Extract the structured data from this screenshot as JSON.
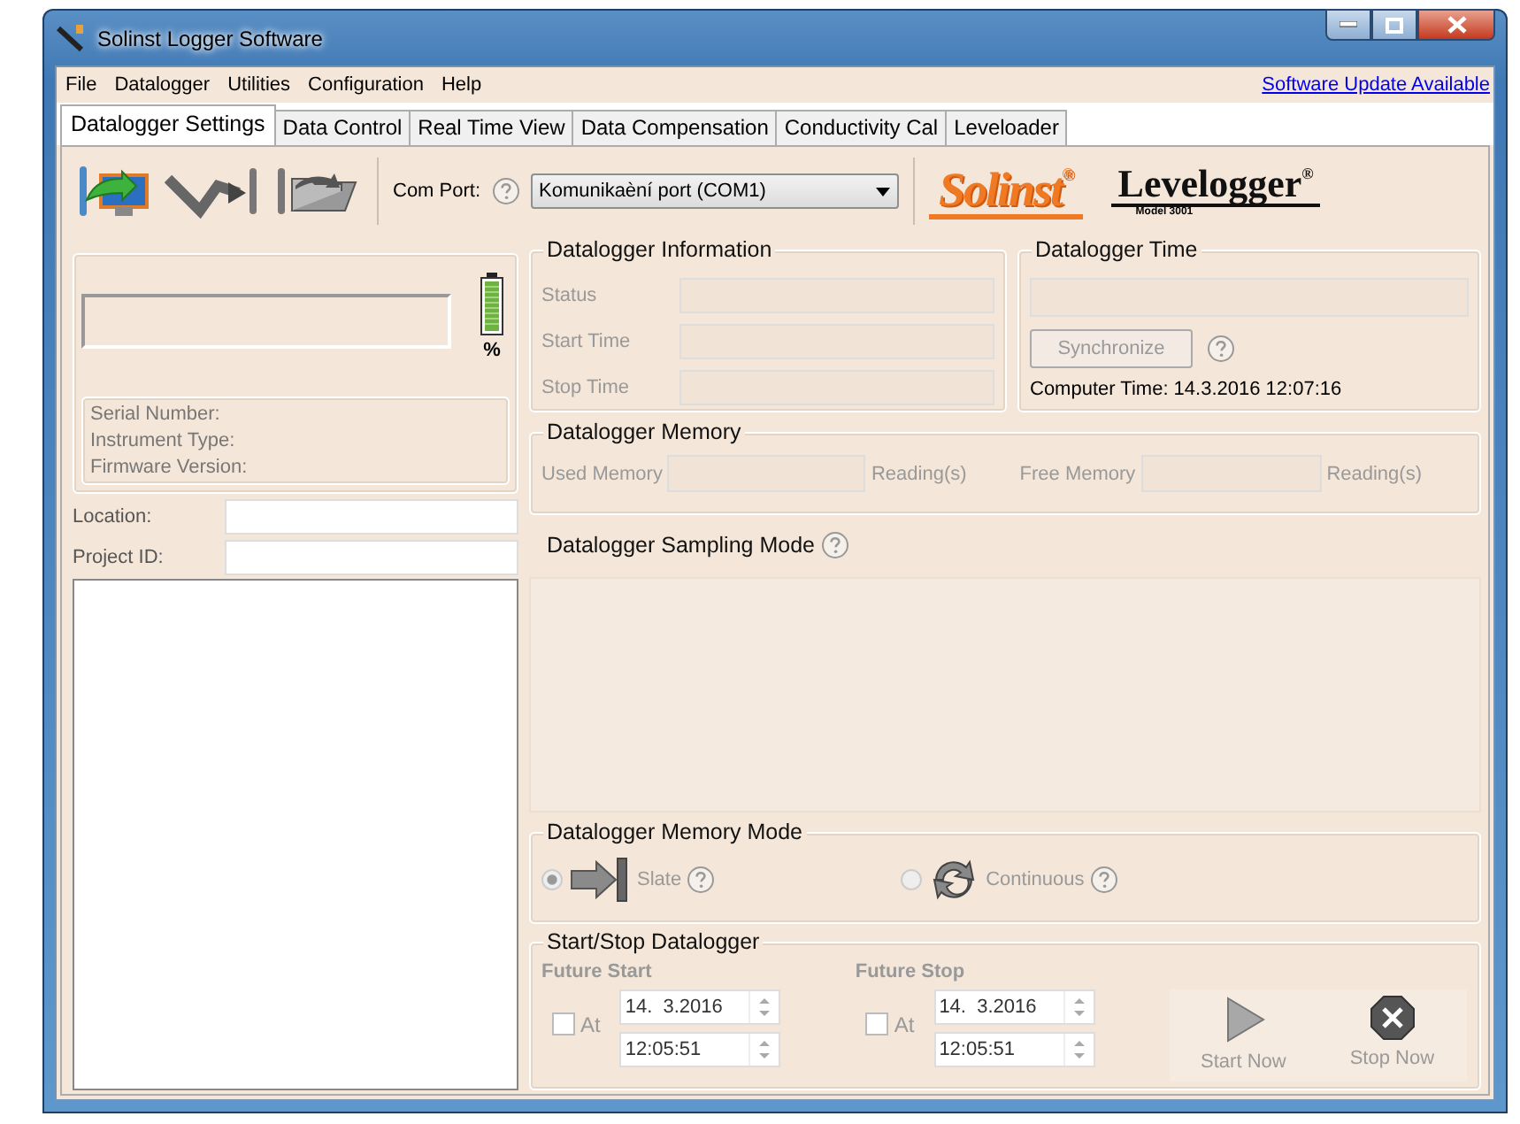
{
  "window": {
    "title": "Solinst Logger Software"
  },
  "menu": [
    "File",
    "Datalogger",
    "Utilities",
    "Configuration",
    "Help"
  ],
  "update_link": "Software Update Available",
  "tabs": [
    {
      "label": "Datalogger Settings",
      "selected": true
    },
    {
      "label": "Data Control",
      "selected": false
    },
    {
      "label": "Real Time View",
      "selected": false
    },
    {
      "label": "Data Compensation",
      "selected": false
    },
    {
      "label": "Conductivity Cal",
      "selected": false
    },
    {
      "label": "Leveloader",
      "selected": false
    }
  ],
  "toolbar": {
    "com_port_label": "Com Port:",
    "com_port": "Komunikaèní port (COM1)",
    "brand_logo": "Solinst",
    "product_logo": "Levelogger",
    "registered_mark": "®",
    "model": "Model 3001"
  },
  "left_panel": {
    "battery_unit": "%",
    "info_labels": [
      "Serial Number:",
      "Instrument Type:",
      "Firmware Version:"
    ],
    "fields": [
      {
        "label": "Location:"
      },
      {
        "label": "Project ID:"
      }
    ]
  },
  "datalogger_information": {
    "title": "Datalogger Information",
    "disabled": true,
    "fields": [
      {
        "label": "Status"
      },
      {
        "label": "Start Time"
      },
      {
        "label": "Stop Time"
      }
    ]
  },
  "datalogger_time": {
    "title": "Datalogger Time",
    "sync_button": "Synchronize",
    "sync_disabled": true,
    "computer_time": "Computer Time: 14.3.2016 12:07:16"
  },
  "datalogger_memory": {
    "title": "Datalogger Memory",
    "disabled": true,
    "used_label": "Used Memory",
    "used_unit": "Reading(s)",
    "free_label": "Free Memory",
    "free_unit": "Reading(s)"
  },
  "sampling_mode": {
    "title": "Datalogger Sampling Mode"
  },
  "memory_mode": {
    "title": "Datalogger Memory Mode",
    "disabled": true,
    "options": [
      {
        "kind": "slate",
        "label": "Slate",
        "selected": true
      },
      {
        "kind": "continuous",
        "label": "Continuous",
        "selected": false
      }
    ]
  },
  "start_stop": {
    "title": "Start/Stop Datalogger",
    "disabled": true,
    "schedules": [
      {
        "title": "Future Start",
        "checkbox_label": "At",
        "checked": false,
        "date": "14.  3.2016",
        "time": "12:05:51"
      },
      {
        "title": "Future Stop",
        "checkbox_label": "At",
        "checked": false,
        "date": "14.  3.2016",
        "time": "12:05:51"
      }
    ],
    "actions": [
      {
        "kind": "start",
        "label": "Start Now"
      },
      {
        "kind": "stop",
        "label": "Stop Now"
      }
    ]
  }
}
